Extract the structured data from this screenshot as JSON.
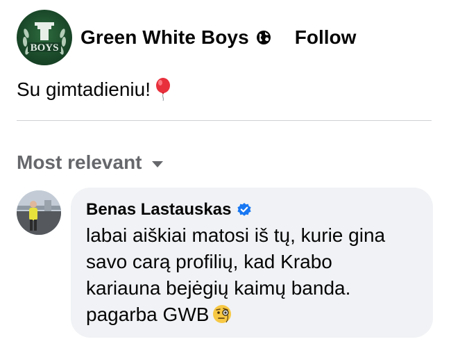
{
  "post": {
    "page_name": "Green White Boys",
    "avatar_text": "BOYS",
    "follow_label": "Follow",
    "text": "Su gimtadieniu!",
    "balloon_icon": "balloon-icon",
    "privacy_icon": "globe-icon"
  },
  "comments_section": {
    "sort_label": "Most relevant",
    "sort_icon": "caret-down-icon"
  },
  "comment": {
    "author": "Benas Lastauskas",
    "verified_icon": "verified-badge-icon",
    "lines": [
      "labai aiškiai matosi iš tų, kurie gina",
      "savo carą profilių, kad Krabo",
      "kariauna bejėgių kaimų banda.",
      "pagarba GWB"
    ],
    "emoji_icon": "face-with-monocle-emoji"
  },
  "colors": {
    "text_primary": "#050505",
    "text_secondary": "#65676b",
    "bubble_bg": "#f0f2f5",
    "divider": "#ced0d4",
    "verified_blue": "#1877f2",
    "avatar_green": "#1b4a2a"
  }
}
